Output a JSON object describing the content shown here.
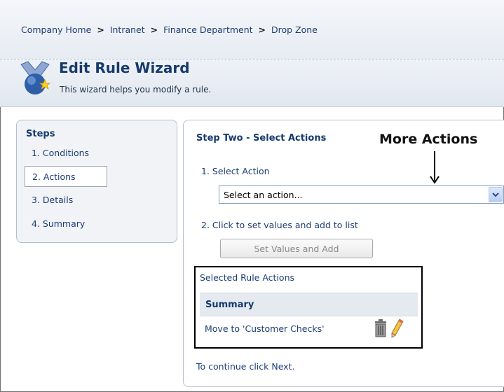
{
  "breadcrumb": {
    "items": [
      "Company Home",
      "Intranet",
      "Finance Department",
      "Drop Zone"
    ],
    "separator": ">"
  },
  "header": {
    "title": "Edit Rule Wizard",
    "subtitle": "This wizard helps you modify a rule."
  },
  "steps": {
    "title": "Steps",
    "items": [
      "1. Conditions",
      "2. Actions",
      "3. Details",
      "4. Summary"
    ],
    "active_index": 1
  },
  "main": {
    "heading": "Step Two - Select Actions",
    "annotation": "More Actions",
    "select_action_label": "1. Select Action",
    "select_value": "Select an action...",
    "set_values_label": "2. Click to set values and add to list",
    "set_values_button": "Set Values and Add",
    "selected_title": "Selected Rule Actions",
    "summary_header": "Summary",
    "rows": [
      "Move to 'Customer Checks'"
    ],
    "continue_text": "To continue click Next."
  },
  "icons": {
    "wizard": "wizard-icon",
    "dropdown": "chevron-down-icon",
    "delete": "trash-icon",
    "edit": "pencil-icon",
    "annotation_arrow": "arrow-down-icon"
  }
}
